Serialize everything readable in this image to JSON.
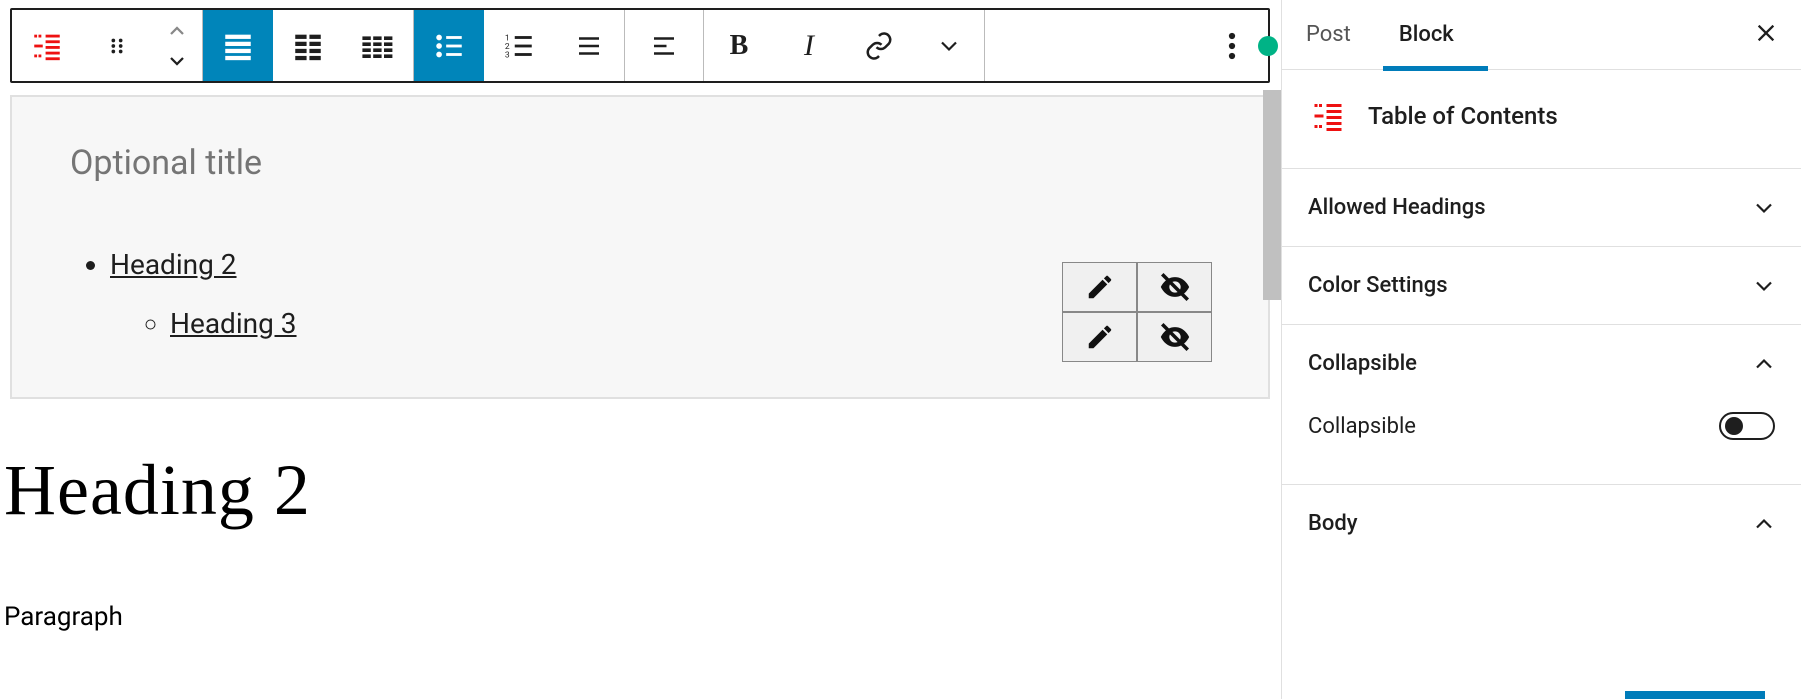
{
  "toolbar": {
    "groups": [
      "block-type",
      "columns",
      "list-style",
      "text-align",
      "inline",
      "more"
    ]
  },
  "toc_block": {
    "title_placeholder": "Optional title",
    "items": [
      {
        "label": "Heading 2",
        "children": [
          {
            "label": "Heading 3"
          }
        ]
      }
    ]
  },
  "content": {
    "heading2": "Heading 2",
    "paragraph": "Paragraph"
  },
  "sidebar": {
    "tabs": {
      "post": "Post",
      "block": "Block"
    },
    "block_title": "Table of Contents",
    "panels": {
      "allowed_headings": "Allowed Headings",
      "color_settings": "Color Settings",
      "collapsible": "Collapsible",
      "collapsible_toggle_label": "Collapsible",
      "collapsible_value": false,
      "body": "Body"
    }
  }
}
